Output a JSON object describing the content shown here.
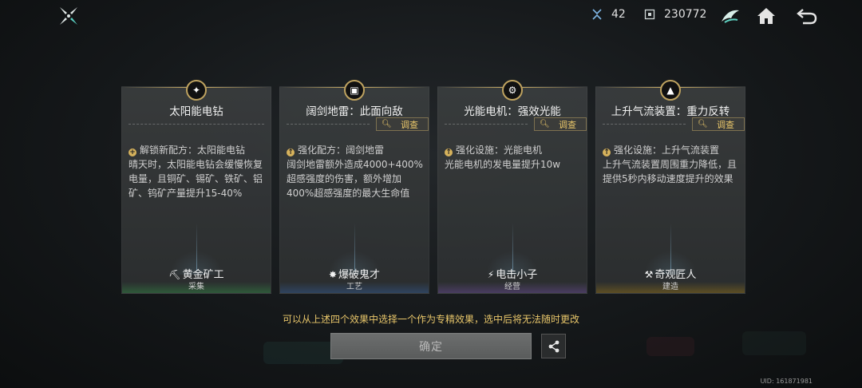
{
  "topbar": {
    "resource_a": "42",
    "resource_b": "230772",
    "icons": [
      "crystal-icon",
      "chip-icon",
      "faction-emblem-icon",
      "home-icon",
      "back-icon"
    ]
  },
  "cards": [
    {
      "title": "太阳能电钻",
      "inspect": "",
      "desc": "解锁新配方：太阳能电钻\n晴天时，太阳能电钻会缓慢恢复电量，且铜矿、锡矿、铁矿、铝矿、钨矿产量提升15-40%",
      "role": "黄金矿工",
      "category": "采集",
      "cat_color": "#2f5a3a"
    },
    {
      "title": "阔剑地雷：此面向敌",
      "inspect": "调查",
      "desc": "强化配方：阔剑地雷\n阔剑地雷额外造成4000+400%超感强度的伤害，额外增加400%超感强度的最大生命值",
      "role": "爆破鬼才",
      "category": "工艺",
      "cat_color": "#2f4460"
    },
    {
      "title": "光能电机：强效光能",
      "inspect": "调查",
      "desc": "强化设施：光能电机\n光能电机的发电量提升10w",
      "role": "电击小子",
      "category": "经营",
      "cat_color": "#4a3d62"
    },
    {
      "title": "上升气流装置：重力反转",
      "inspect": "调查",
      "desc": "强化设施：上升气流装置\n上升气流装置周围重力降低，且提供5秒内移动速度提升的效果",
      "role": "奇观匠人",
      "category": "建造",
      "cat_color": "#5e4f24"
    }
  ],
  "hint": "可以从上述四个效果中选择一个作为专精效果，选中后将无法随时更改",
  "confirm_label": "确定",
  "uid": "UID: 161871981"
}
